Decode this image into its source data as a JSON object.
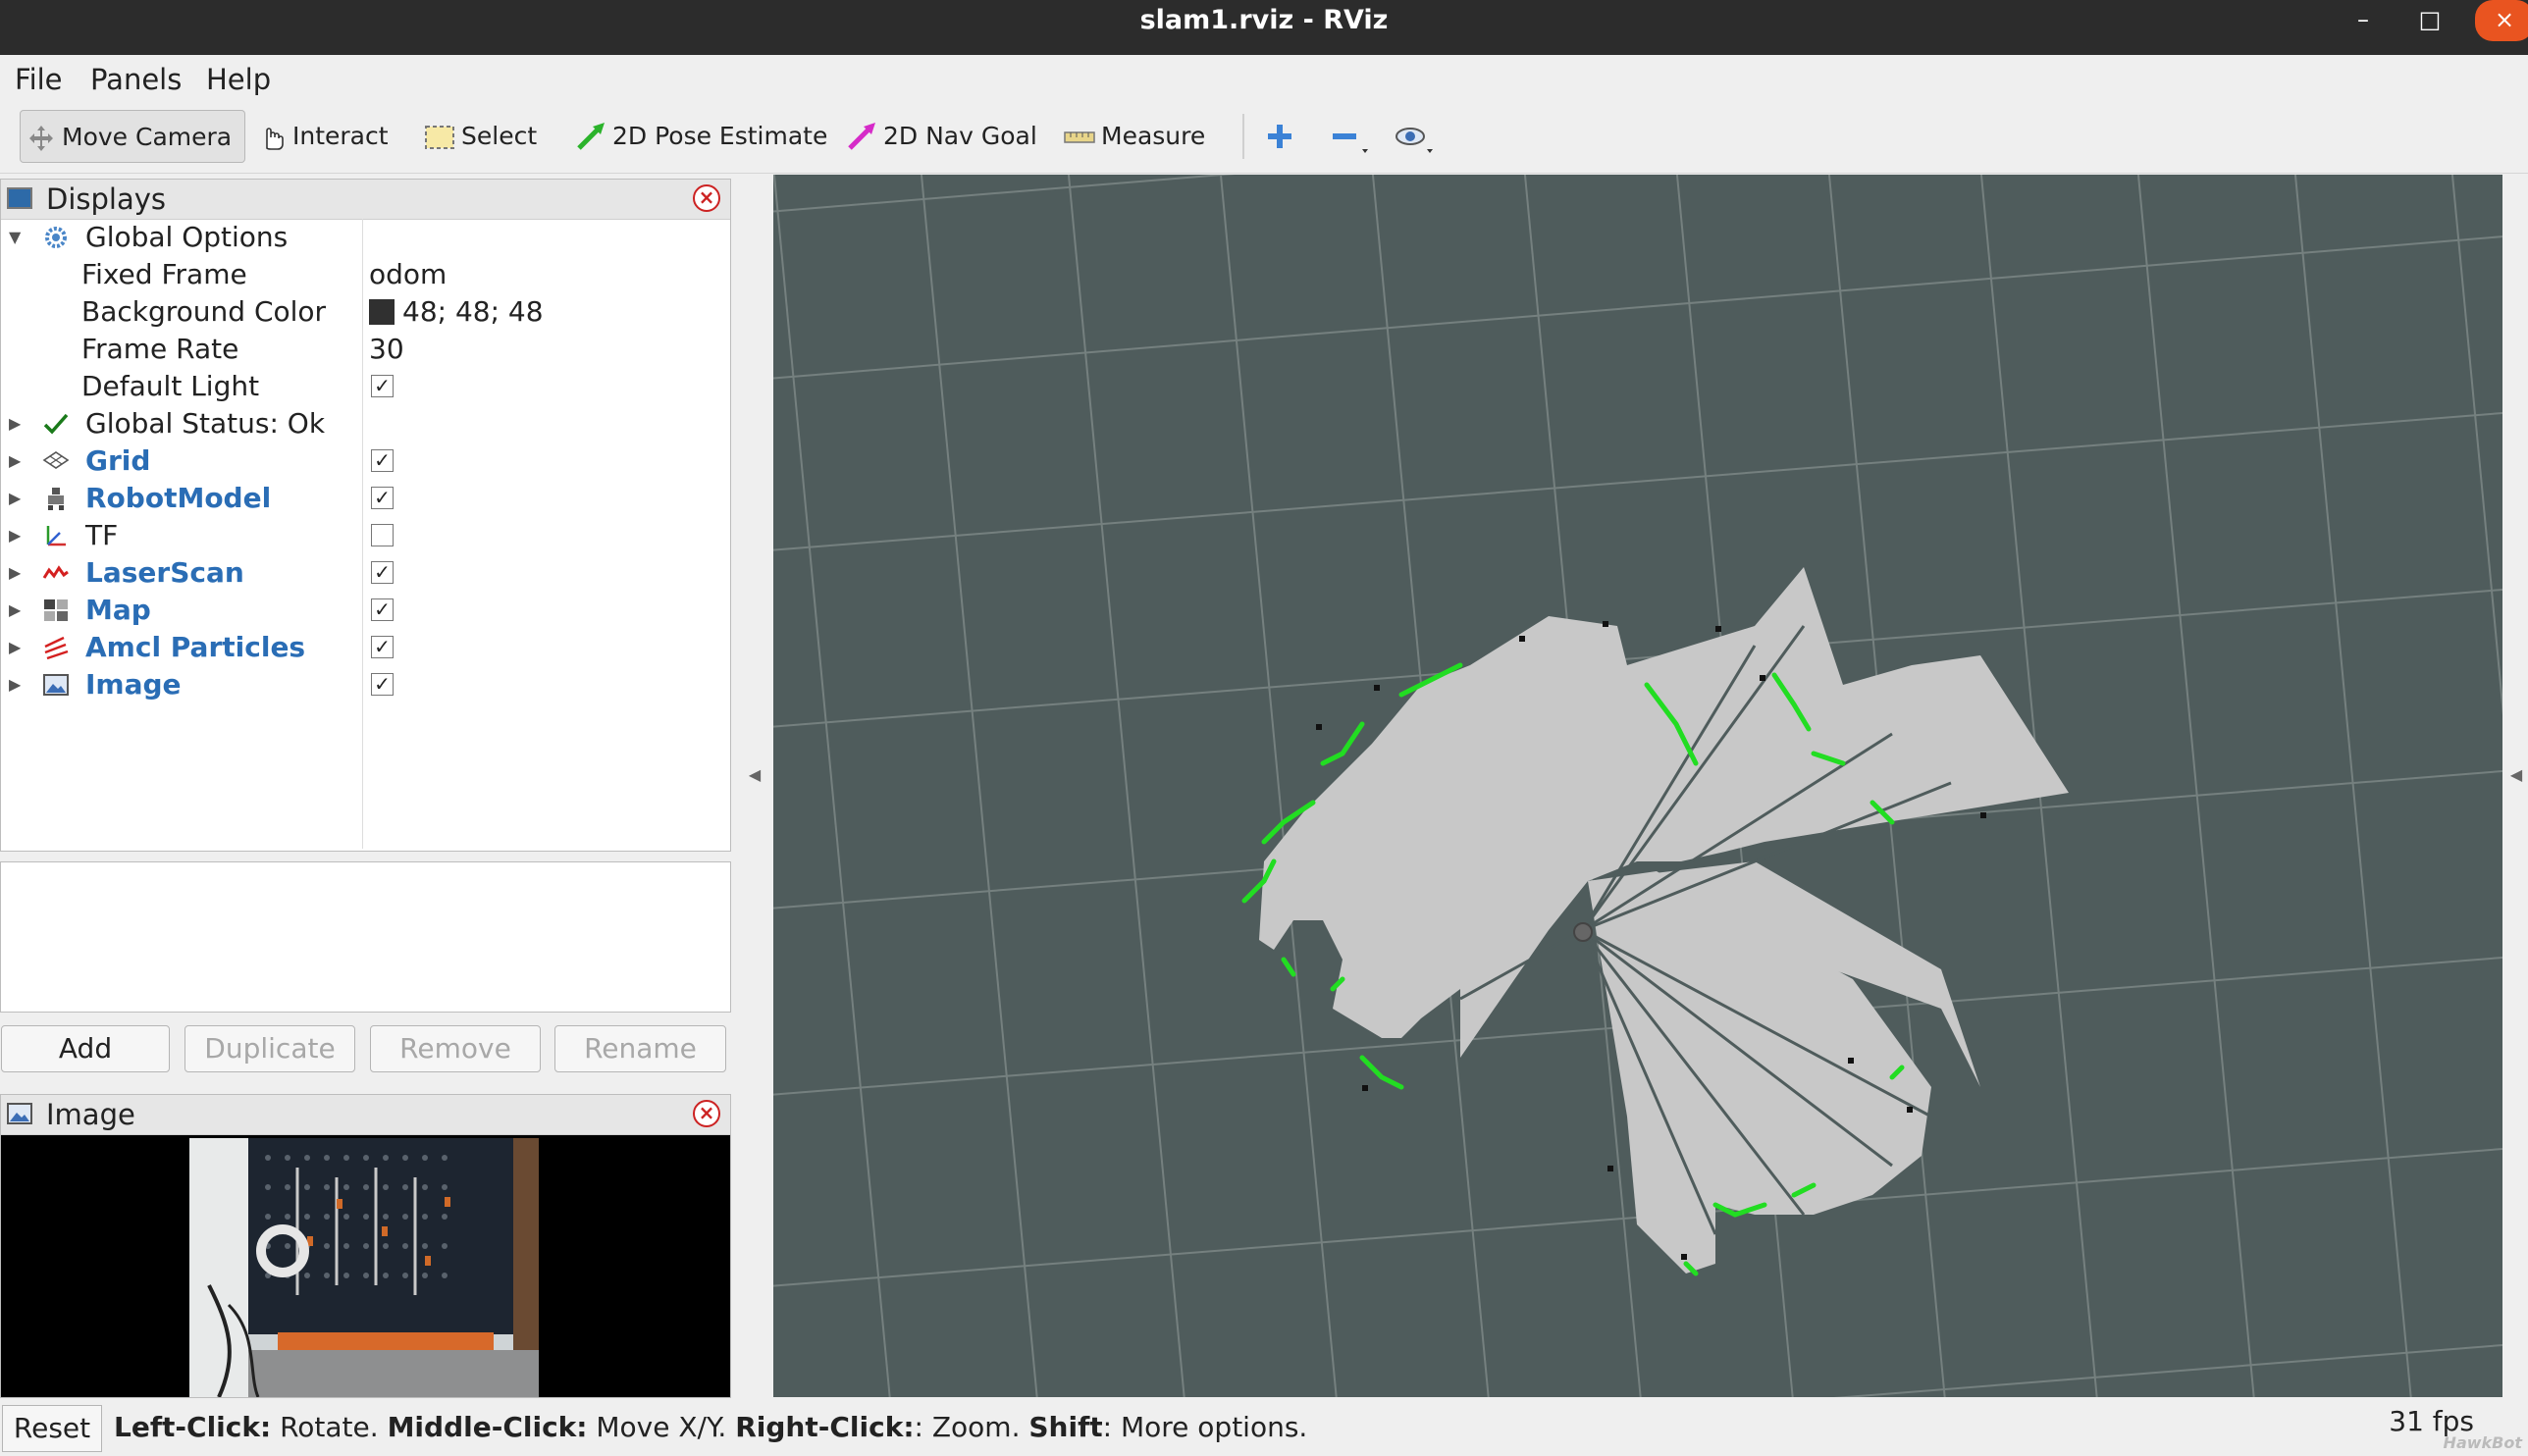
{
  "window": {
    "title": "slam1.rviz - RViz",
    "minimize": "–",
    "maximize": "□",
    "close": "×"
  },
  "menu": [
    "File",
    "Panels",
    "Help"
  ],
  "toolbar": {
    "move_camera": "Move Camera",
    "interact": "Interact",
    "select": "Select",
    "pose_estimate": "2D Pose Estimate",
    "nav_goal": "2D Nav Goal",
    "measure": "Measure"
  },
  "displays": {
    "title": "Displays",
    "global_options": "Global Options",
    "fixed_frame_label": "Fixed Frame",
    "fixed_frame_value": "odom",
    "bg_color_label": "Background Color",
    "bg_color_value": "48; 48; 48",
    "frame_rate_label": "Frame Rate",
    "frame_rate_value": "30",
    "default_light_label": "Default Light",
    "default_light_checked": true,
    "global_status": "Global Status: Ok",
    "items": [
      {
        "label": "Grid",
        "checked": true
      },
      {
        "label": "RobotModel",
        "checked": true
      },
      {
        "label": "TF",
        "checked": false
      },
      {
        "label": "LaserScan",
        "checked": true
      },
      {
        "label": "Map",
        "checked": true
      },
      {
        "label": "Amcl Particles",
        "checked": true
      },
      {
        "label": "Image",
        "checked": true
      }
    ]
  },
  "buttons": {
    "add": "Add",
    "duplicate": "Duplicate",
    "remove": "Remove",
    "rename": "Rename"
  },
  "image_panel": {
    "title": "Image"
  },
  "status": {
    "reset": "Reset",
    "left_click_key": "Left-Click:",
    "left_click_action": " Rotate. ",
    "middle_click_key": "Middle-Click:",
    "middle_click_action": " Move X/Y. ",
    "right_click_key": "Right-Click:",
    "right_click_action": ": Zoom. ",
    "shift_key": "Shift",
    "shift_action": ": More options.",
    "fps": "31 fps"
  },
  "watermark": "HawkBot",
  "colors": {
    "background": "#303030",
    "scan_points": "#22dd22",
    "map_free": "#c8c8c8"
  }
}
